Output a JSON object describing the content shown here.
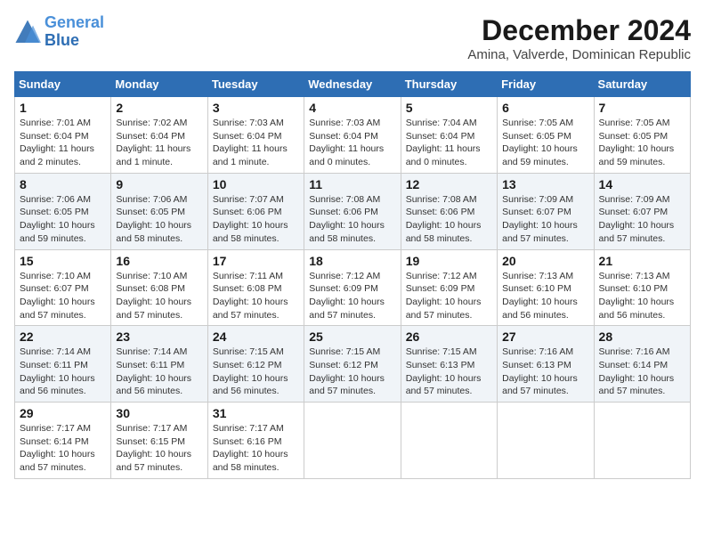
{
  "logo": {
    "line1": "General",
    "line2": "Blue"
  },
  "title": {
    "month_year": "December 2024",
    "location": "Amina, Valverde, Dominican Republic"
  },
  "weekdays": [
    "Sunday",
    "Monday",
    "Tuesday",
    "Wednesday",
    "Thursday",
    "Friday",
    "Saturday"
  ],
  "weeks": [
    [
      {
        "day": "1",
        "info": "Sunrise: 7:01 AM\nSunset: 6:04 PM\nDaylight: 11 hours and 2 minutes."
      },
      {
        "day": "2",
        "info": "Sunrise: 7:02 AM\nSunset: 6:04 PM\nDaylight: 11 hours and 1 minute."
      },
      {
        "day": "3",
        "info": "Sunrise: 7:03 AM\nSunset: 6:04 PM\nDaylight: 11 hours and 1 minute."
      },
      {
        "day": "4",
        "info": "Sunrise: 7:03 AM\nSunset: 6:04 PM\nDaylight: 11 hours and 0 minutes."
      },
      {
        "day": "5",
        "info": "Sunrise: 7:04 AM\nSunset: 6:04 PM\nDaylight: 11 hours and 0 minutes."
      },
      {
        "day": "6",
        "info": "Sunrise: 7:05 AM\nSunset: 6:05 PM\nDaylight: 10 hours and 59 minutes."
      },
      {
        "day": "7",
        "info": "Sunrise: 7:05 AM\nSunset: 6:05 PM\nDaylight: 10 hours and 59 minutes."
      }
    ],
    [
      {
        "day": "8",
        "info": "Sunrise: 7:06 AM\nSunset: 6:05 PM\nDaylight: 10 hours and 59 minutes."
      },
      {
        "day": "9",
        "info": "Sunrise: 7:06 AM\nSunset: 6:05 PM\nDaylight: 10 hours and 58 minutes."
      },
      {
        "day": "10",
        "info": "Sunrise: 7:07 AM\nSunset: 6:06 PM\nDaylight: 10 hours and 58 minutes."
      },
      {
        "day": "11",
        "info": "Sunrise: 7:08 AM\nSunset: 6:06 PM\nDaylight: 10 hours and 58 minutes."
      },
      {
        "day": "12",
        "info": "Sunrise: 7:08 AM\nSunset: 6:06 PM\nDaylight: 10 hours and 58 minutes."
      },
      {
        "day": "13",
        "info": "Sunrise: 7:09 AM\nSunset: 6:07 PM\nDaylight: 10 hours and 57 minutes."
      },
      {
        "day": "14",
        "info": "Sunrise: 7:09 AM\nSunset: 6:07 PM\nDaylight: 10 hours and 57 minutes."
      }
    ],
    [
      {
        "day": "15",
        "info": "Sunrise: 7:10 AM\nSunset: 6:07 PM\nDaylight: 10 hours and 57 minutes."
      },
      {
        "day": "16",
        "info": "Sunrise: 7:10 AM\nSunset: 6:08 PM\nDaylight: 10 hours and 57 minutes."
      },
      {
        "day": "17",
        "info": "Sunrise: 7:11 AM\nSunset: 6:08 PM\nDaylight: 10 hours and 57 minutes."
      },
      {
        "day": "18",
        "info": "Sunrise: 7:12 AM\nSunset: 6:09 PM\nDaylight: 10 hours and 57 minutes."
      },
      {
        "day": "19",
        "info": "Sunrise: 7:12 AM\nSunset: 6:09 PM\nDaylight: 10 hours and 57 minutes."
      },
      {
        "day": "20",
        "info": "Sunrise: 7:13 AM\nSunset: 6:10 PM\nDaylight: 10 hours and 56 minutes."
      },
      {
        "day": "21",
        "info": "Sunrise: 7:13 AM\nSunset: 6:10 PM\nDaylight: 10 hours and 56 minutes."
      }
    ],
    [
      {
        "day": "22",
        "info": "Sunrise: 7:14 AM\nSunset: 6:11 PM\nDaylight: 10 hours and 56 minutes."
      },
      {
        "day": "23",
        "info": "Sunrise: 7:14 AM\nSunset: 6:11 PM\nDaylight: 10 hours and 56 minutes."
      },
      {
        "day": "24",
        "info": "Sunrise: 7:15 AM\nSunset: 6:12 PM\nDaylight: 10 hours and 56 minutes."
      },
      {
        "day": "25",
        "info": "Sunrise: 7:15 AM\nSunset: 6:12 PM\nDaylight: 10 hours and 57 minutes."
      },
      {
        "day": "26",
        "info": "Sunrise: 7:15 AM\nSunset: 6:13 PM\nDaylight: 10 hours and 57 minutes."
      },
      {
        "day": "27",
        "info": "Sunrise: 7:16 AM\nSunset: 6:13 PM\nDaylight: 10 hours and 57 minutes."
      },
      {
        "day": "28",
        "info": "Sunrise: 7:16 AM\nSunset: 6:14 PM\nDaylight: 10 hours and 57 minutes."
      }
    ],
    [
      {
        "day": "29",
        "info": "Sunrise: 7:17 AM\nSunset: 6:14 PM\nDaylight: 10 hours and 57 minutes."
      },
      {
        "day": "30",
        "info": "Sunrise: 7:17 AM\nSunset: 6:15 PM\nDaylight: 10 hours and 57 minutes."
      },
      {
        "day": "31",
        "info": "Sunrise: 7:17 AM\nSunset: 6:16 PM\nDaylight: 10 hours and 58 minutes."
      },
      {
        "day": "",
        "info": ""
      },
      {
        "day": "",
        "info": ""
      },
      {
        "day": "",
        "info": ""
      },
      {
        "day": "",
        "info": ""
      }
    ]
  ]
}
